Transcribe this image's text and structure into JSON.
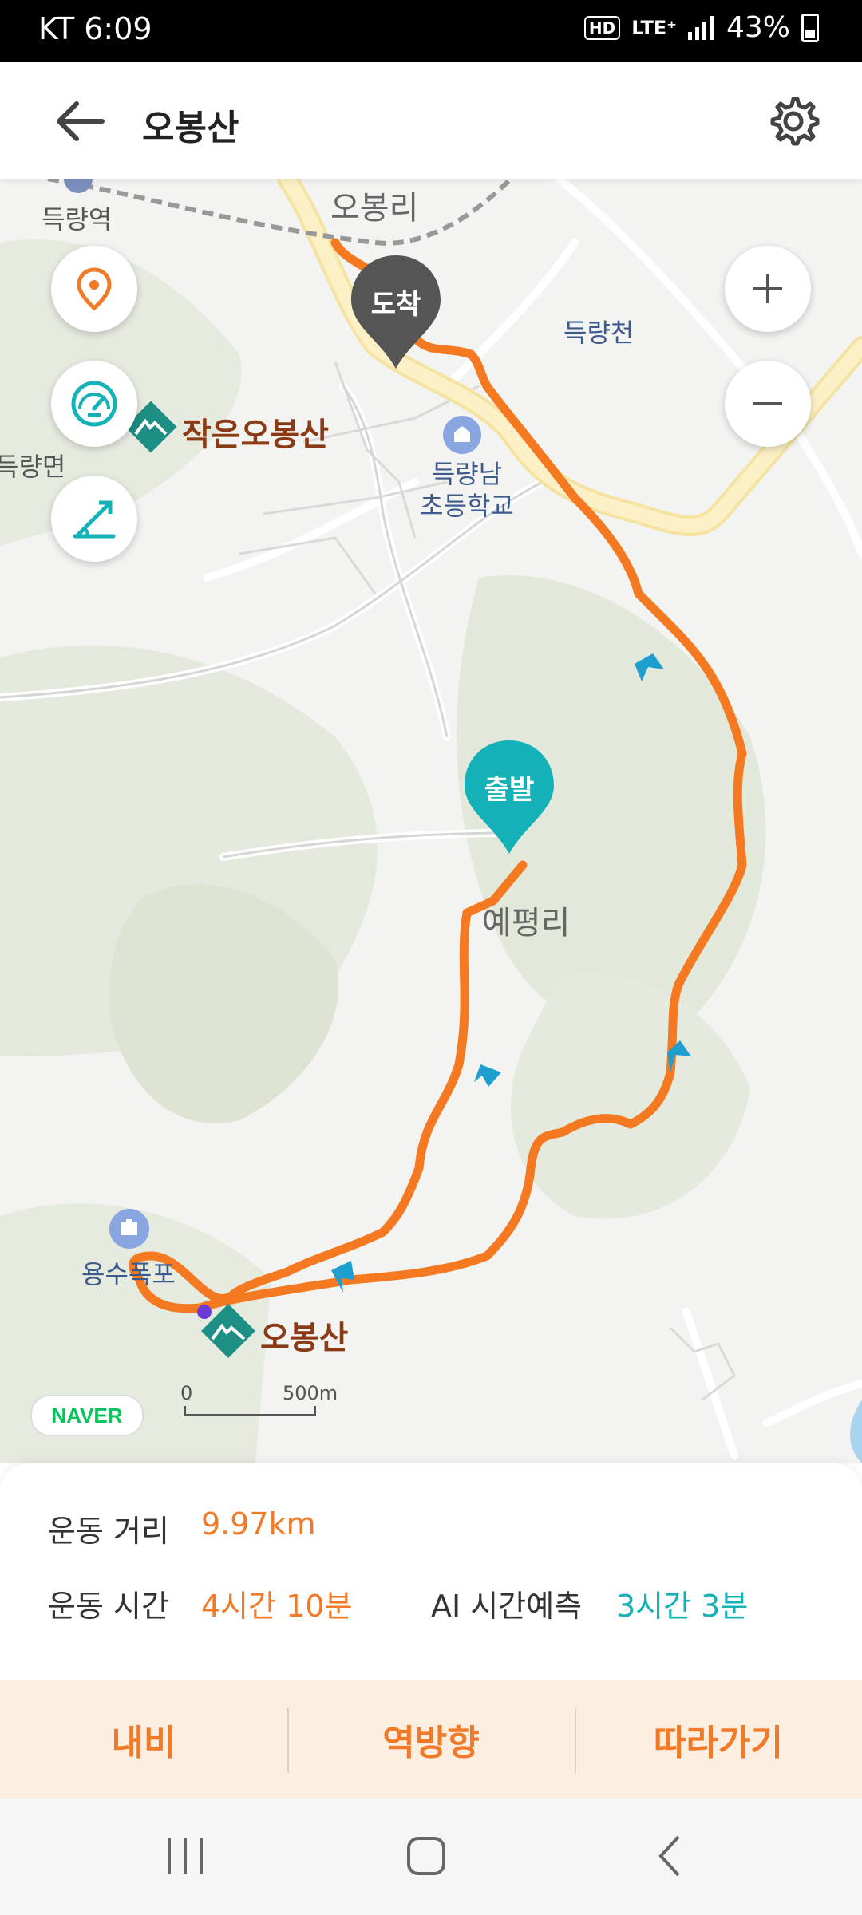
{
  "status": {
    "carrier_time": "KT  6:09",
    "lte": "LTE⁺",
    "battery": "43%"
  },
  "header": {
    "title": "오봉산",
    "back_icon": "arrow-left-icon",
    "settings_icon": "gear-icon"
  },
  "map": {
    "labels": {
      "station": "득량역",
      "obongri": "오봉리",
      "stream": "득량천",
      "small_mountain": "작은오봉산",
      "township": "득량면",
      "school": "득량남\n초등학교",
      "yepyeongri": "예평리",
      "waterfall": "용수폭포",
      "mountain": "오봉산"
    },
    "pins": {
      "start": "출발",
      "end": "도착"
    },
    "scale": {
      "zero": "0",
      "dist": "500m"
    },
    "naver": "NAVER"
  },
  "stats": {
    "distance_label": "운동 거리",
    "distance_value": "9.97km",
    "time_label": "운동 시간",
    "time_value": "4시간 10분",
    "ai_label": "AI 시간예측",
    "ai_value": "3시간 3분"
  },
  "actions": {
    "navi": "내비",
    "reverse": "역방향",
    "follow": "따라가기"
  },
  "colors": {
    "accent": "#f07a28",
    "teal": "#14b1b8",
    "route": "#f47920"
  }
}
